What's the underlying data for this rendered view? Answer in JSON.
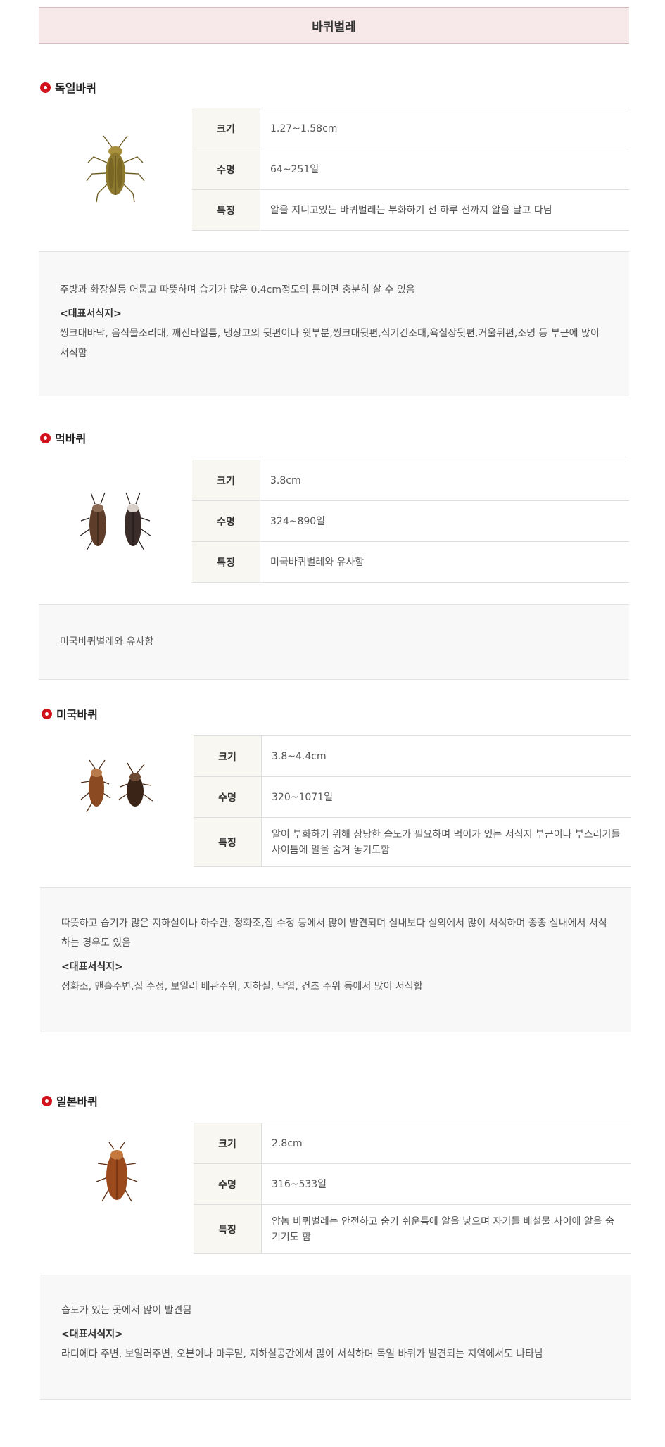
{
  "page_title": "바퀴벌레",
  "labels": {
    "size": "크기",
    "lifespan": "수명",
    "feature": "특징",
    "habitat_heading": "<대표서식지>"
  },
  "species": [
    {
      "name": "독일바퀴",
      "size": "1.27~1.58cm",
      "lifespan": "64~251일",
      "feature": "알을 지니고있는 바퀴벌레는 부화하기 전 하루 전까지 알을 달고 다님",
      "desc": "주방과 화장실등 어둡고 따뜻하며 습기가 많은 0.4cm정도의 틈이면 충분히 살 수 있음",
      "habitat": "씽크대바닥, 음식물조리대, 깨진타일틈, 냉장고의 뒷편이나 윗부분,씽크대뒷편,식기건조대,욕실장뒷편,거울뒤편,조명 등 부근에 많이 서식함"
    },
    {
      "name": "먹바퀴",
      "size": "3.8cm",
      "lifespan": "324~890일",
      "feature": "미국바퀴벌레와 유사함",
      "desc": "미국바퀴벌레와 유사함"
    },
    {
      "name": "미국바퀴",
      "size": "3.8~4.4cm",
      "lifespan": "320~1071일",
      "feature": "알이 부화하기 위해 상당한 습도가 필요하며 먹이가 있는 서식지 부근이나 부스러기들 사이틈에 알을 숨겨 놓기도함",
      "desc": "따뜻하고 습기가 많은 지하실이나 하수관, 정화조,집 수정 등에서 많이 발견되며 실내보다 실외에서 많이 서식하며 종종 실내에서 서식하는 경우도 있음",
      "habitat": "정화조, 맨홀주변,집 수정, 보일러 배관주위, 지하실, 낙엽, 건초 주위 등에서 많이 서식합"
    },
    {
      "name": "일본바퀴",
      "size": "2.8cm",
      "lifespan": "316~533일",
      "feature": "암놈 바퀴벌레는 안전하고 숨기 쉬운틈에 알을 낳으며 자기들 배설물 사이에 알을 숨기기도 함",
      "desc": "습도가 있는 곳에서 많이 발견됨",
      "habitat": "라디에다 주변, 보일러주변, 오븐이나 마루밑, 지하실공간에서 많이 서식하며 독일 바퀴가 발견되는 지역에서도 나타남"
    }
  ]
}
